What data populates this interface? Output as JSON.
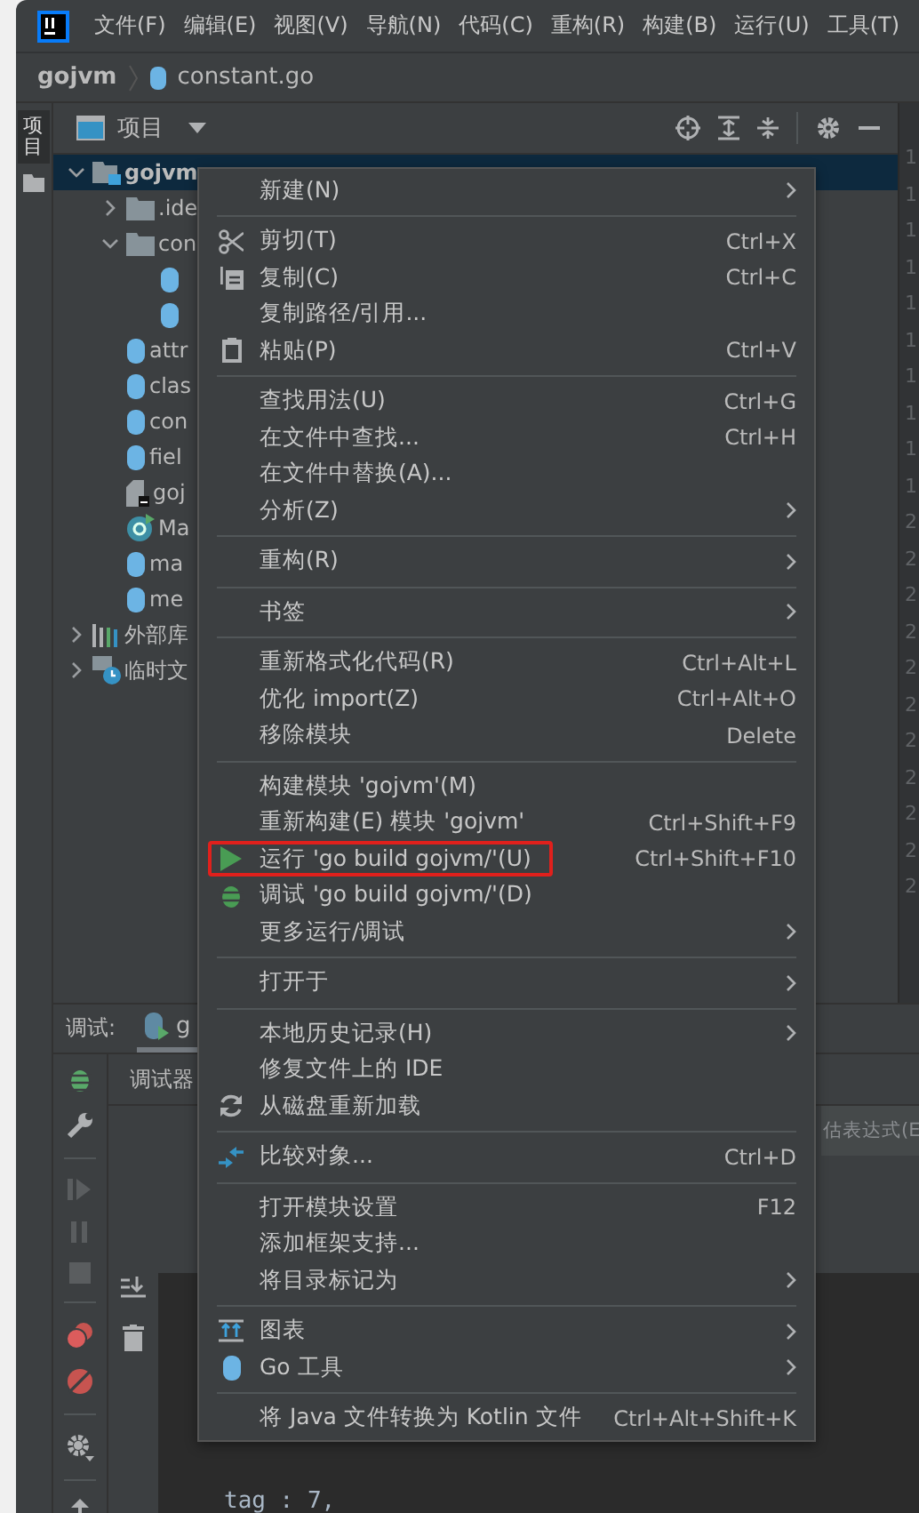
{
  "menu_bar": {
    "items": [
      "文件(F)",
      "编辑(E)",
      "视图(V)",
      "导航(N)",
      "代码(C)",
      "重构(R)",
      "构建(B)",
      "运行(U)",
      "工具(T)"
    ]
  },
  "breadcrumb": {
    "items": [
      {
        "label": "gojvm",
        "kind": "project"
      },
      {
        "label": "constant.go",
        "kind": "gofile"
      }
    ]
  },
  "tool_strip": {
    "items": [
      {
        "label": "项目",
        "selected": true
      }
    ]
  },
  "project_panel": {
    "title": "项目",
    "tree": [
      {
        "label": "gojvm",
        "kind": "module",
        "expanded": true,
        "selected": true,
        "children": [
          {
            "label": ".ide",
            "kind": "folder",
            "expanded": false
          },
          {
            "label": "con",
            "kind": "folder",
            "expanded": true,
            "children": [
              {
                "kind": "gofile"
              },
              {
                "kind": "gofile"
              }
            ]
          },
          {
            "label": "attr",
            "kind": "gofile"
          },
          {
            "label": "clas",
            "kind": "gofile"
          },
          {
            "label": "con",
            "kind": "gofile"
          },
          {
            "label": "fiel",
            "kind": "gofile"
          },
          {
            "label": "goj",
            "kind": "binary"
          },
          {
            "label": "Ma",
            "kind": "runconfig"
          },
          {
            "label": "ma",
            "kind": "gofile"
          },
          {
            "label": "me",
            "kind": "gofile"
          }
        ]
      },
      {
        "label": "外部库",
        "kind": "library",
        "expanded": false,
        "selected": false
      },
      {
        "label": "临时文",
        "kind": "scratch",
        "expanded": false,
        "selected": false
      }
    ]
  },
  "editor_gutter": {
    "line_numbers": [
      "1",
      "1",
      "1",
      "1",
      "1",
      "1",
      "1",
      "1",
      "1",
      "1",
      "2",
      "2",
      "2",
      "2",
      "2",
      "2",
      "2",
      "2",
      "2",
      "2",
      "2"
    ]
  },
  "context_menu": {
    "sections": [
      {
        "items": [
          {
            "label": "新建(N)",
            "kind": "plain",
            "submenu": true,
            "highlighted": false
          }
        ]
      },
      {
        "items": [
          {
            "label": "剪切(T)",
            "kind": "cut",
            "shortcut": "Ctrl+X",
            "submenu": false,
            "highlighted": false
          },
          {
            "label": "复制(C)",
            "kind": "copy",
            "shortcut": "Ctrl+C",
            "submenu": false,
            "highlighted": false
          },
          {
            "label": "复制路径/引用...",
            "kind": "plain",
            "submenu": false,
            "highlighted": false
          },
          {
            "label": "粘贴(P)",
            "kind": "paste",
            "shortcut": "Ctrl+V",
            "submenu": false,
            "highlighted": false
          }
        ]
      },
      {
        "items": [
          {
            "label": "查找用法(U)",
            "kind": "plain",
            "shortcut": "Ctrl+G",
            "submenu": false,
            "highlighted": false
          },
          {
            "label": "在文件中查找...",
            "kind": "plain",
            "shortcut": "Ctrl+H",
            "submenu": false,
            "highlighted": false
          },
          {
            "label": "在文件中替换(A)...",
            "kind": "plain",
            "submenu": false,
            "highlighted": false
          },
          {
            "label": "分析(Z)",
            "kind": "plain",
            "submenu": true,
            "highlighted": false
          }
        ]
      },
      {
        "items": [
          {
            "label": "重构(R)",
            "kind": "plain",
            "submenu": true,
            "highlighted": false
          }
        ]
      },
      {
        "items": [
          {
            "label": "书签",
            "kind": "plain",
            "submenu": true,
            "highlighted": false
          }
        ]
      },
      {
        "items": [
          {
            "label": "重新格式化代码(R)",
            "kind": "plain",
            "shortcut": "Ctrl+Alt+L",
            "submenu": false,
            "highlighted": false
          },
          {
            "label": "优化 import(Z)",
            "kind": "plain",
            "shortcut": "Ctrl+Alt+O",
            "submenu": false,
            "highlighted": false
          },
          {
            "label": "移除模块",
            "kind": "plain",
            "shortcut": "Delete",
            "submenu": false,
            "highlighted": false
          }
        ]
      },
      {
        "items": [
          {
            "label": "构建模块 'gojvm'(M)",
            "kind": "plain",
            "submenu": false,
            "highlighted": false
          },
          {
            "label": "重新构建(E) 模块 'gojvm'",
            "kind": "plain",
            "shortcut": "Ctrl+Shift+F9",
            "submenu": false,
            "highlighted": false
          },
          {
            "label": "运行 'go build gojvm/'(U)",
            "kind": "run",
            "shortcut": "Ctrl+Shift+F10",
            "submenu": false,
            "highlighted": true
          },
          {
            "label": "调试 'go build gojvm/'(D)",
            "kind": "debug",
            "submenu": false,
            "highlighted": false
          },
          {
            "label": "更多运行/调试",
            "kind": "plain",
            "submenu": true,
            "highlighted": false
          }
        ]
      },
      {
        "items": [
          {
            "label": "打开于",
            "kind": "plain",
            "submenu": true,
            "highlighted": false
          }
        ]
      },
      {
        "items": [
          {
            "label": "本地历史记录(H)",
            "kind": "plain",
            "submenu": true,
            "highlighted": false
          },
          {
            "label": "修复文件上的 IDE",
            "kind": "plain",
            "submenu": false,
            "highlighted": false
          },
          {
            "label": "从磁盘重新加载",
            "kind": "reload",
            "submenu": false,
            "highlighted": false
          }
        ]
      },
      {
        "items": [
          {
            "label": "比较对象...",
            "kind": "compare",
            "shortcut": "Ctrl+D",
            "submenu": false,
            "highlighted": false
          }
        ]
      },
      {
        "items": [
          {
            "label": "打开模块设置",
            "kind": "plain",
            "shortcut": "F12",
            "submenu": false,
            "highlighted": false
          },
          {
            "label": "添加框架支持...",
            "kind": "plain",
            "submenu": false,
            "highlighted": false
          },
          {
            "label": "将目录标记为",
            "kind": "plain",
            "submenu": true,
            "highlighted": false
          }
        ]
      },
      {
        "items": [
          {
            "label": "图表",
            "kind": "diagram",
            "submenu": true,
            "highlighted": false
          },
          {
            "label": "Go 工具",
            "kind": "gopher",
            "submenu": true,
            "highlighted": false
          }
        ]
      },
      {
        "items": [
          {
            "label": "将 Java 文件转换为 Kotlin 文件",
            "kind": "plain",
            "shortcut": "Ctrl+Alt+Shift+K",
            "submenu": false,
            "highlighted": false
          }
        ]
      }
    ]
  },
  "debug_panel": {
    "title": "调试:",
    "tabs": [
      {
        "label": "g",
        "selected": true
      }
    ],
    "subtab": "调试器",
    "expression_placeholder": "估表达式(E",
    "code_line": "tag : 7,"
  }
}
